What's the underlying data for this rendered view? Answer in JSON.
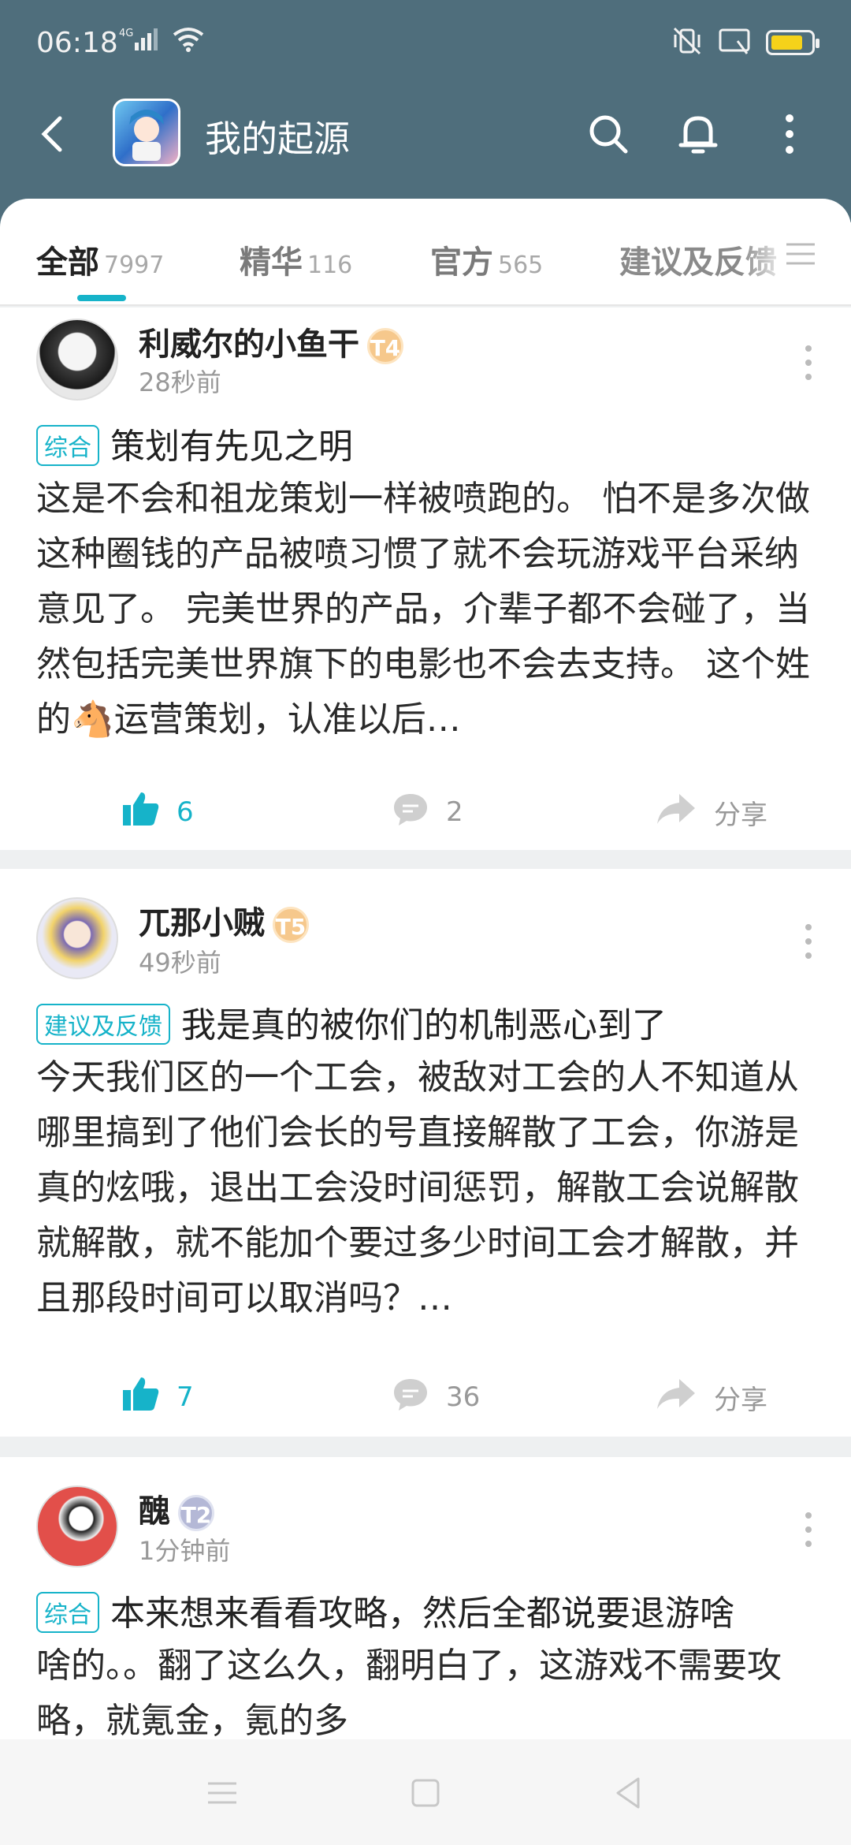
{
  "status_bar": {
    "time": "06:18",
    "network": "4G",
    "battery_level": 0.7,
    "colors": {
      "battery_fill": "#f5d21a"
    }
  },
  "header": {
    "title": "我的起源",
    "background_color": "#4f6e7c",
    "icons": [
      "back-arrow-icon",
      "app-icon",
      "search-icon",
      "bell-icon",
      "more-vertical-icon"
    ]
  },
  "tabs": [
    {
      "label": "全部",
      "count": "7997",
      "active": true
    },
    {
      "label": "精华",
      "count": "116",
      "active": false
    },
    {
      "label": "官方",
      "count": "565",
      "active": false
    },
    {
      "label": "建议及反馈",
      "count": "",
      "active": false
    }
  ],
  "accent_color": "#16b3c9",
  "posts": [
    {
      "username": "利威尔的小鱼干",
      "level": "T4",
      "time": "28秒前",
      "tag": "综合",
      "title": "策划有先见之明",
      "body": "这是不会和祖龙策划一样被喷跑的。 怕不是多次做这种圈钱的产品被喷习惯了就不会玩游戏平台采纳意见了。 完美世界的产品，介辈子都不会碰了，当然包括完美世界旗下的电影也不会去支持。 这个姓的🐴运营策划，认准以后…",
      "likes": "6",
      "comments": "2",
      "share_label": "分享"
    },
    {
      "username": "兀那小贼",
      "level": "T5",
      "time": "49秒前",
      "tag": "建议及反馈",
      "title": "我是真的被你们的机制恶心到了",
      "body": "今天我们区的一个工会，被敌对工会的人不知道从哪里搞到了他们会长的号直接解散了工会，你游是真的炫哦，退出工会没时间惩罚，解散工会说解散就解散，就不能加个要过多少时间工会才解散，并且那段时间可以取消吗？…",
      "likes": "7",
      "comments": "36",
      "share_label": "分享"
    },
    {
      "username": "醜",
      "level": "T2",
      "time": "1分钟前",
      "tag": "综合",
      "title": "本来想来看看攻略，然后全都说要退游啥",
      "body": "啥的。。翻了这么久，翻明白了，这游戏不需要攻略，就氪金，氪的多"
    }
  ],
  "nav_bar": {
    "icons": [
      "menu-icon",
      "home-square-icon",
      "back-triangle-icon"
    ]
  }
}
